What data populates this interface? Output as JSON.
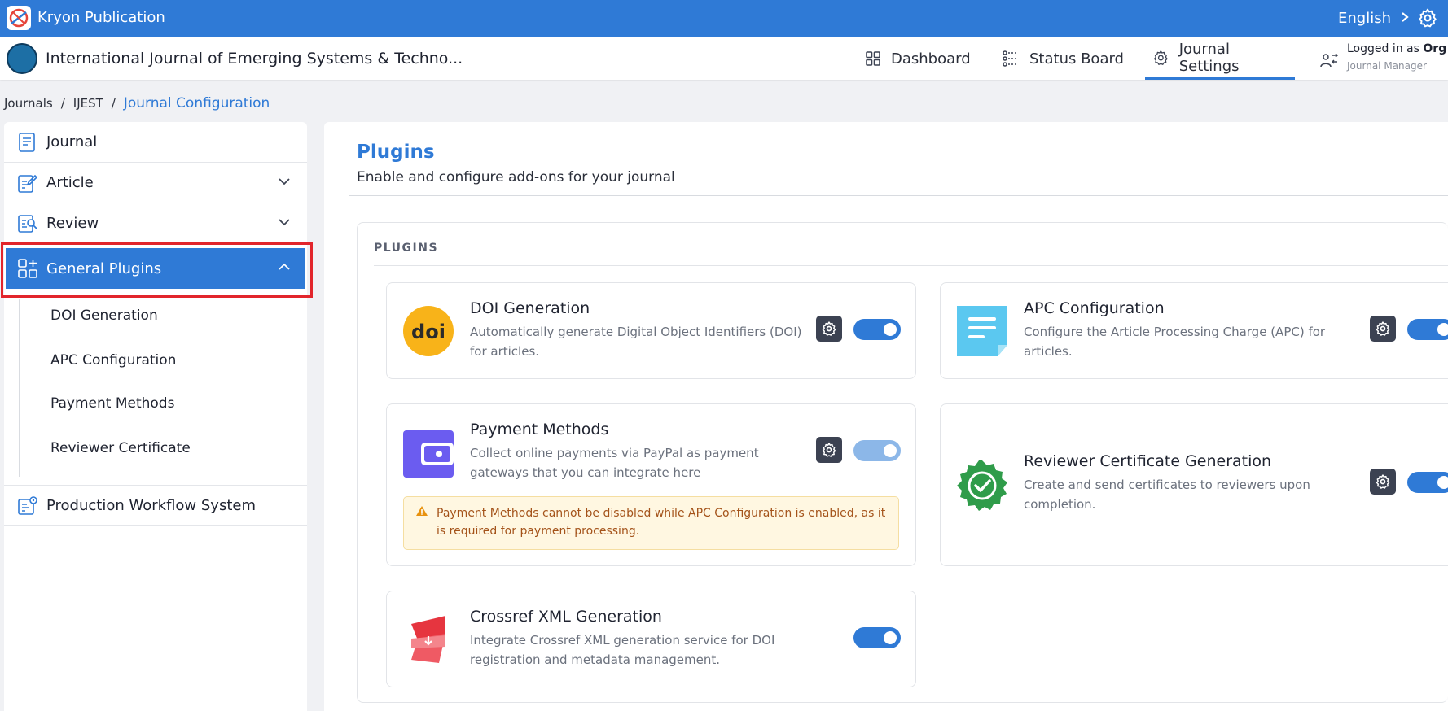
{
  "topbar": {
    "app_title": "Kryon Publication",
    "language": "English",
    "accent_color": "#2f7ad6"
  },
  "journal_bar": {
    "title": "International Journal of Emerging Systems & Techno...",
    "nav": [
      {
        "label": "Dashboard",
        "icon": "grid-icon"
      },
      {
        "label": "Status Board",
        "icon": "status-board-icon"
      },
      {
        "label": "Journal Settings",
        "icon": "gear-icon",
        "active": true
      }
    ],
    "login_prefix": "Logged in as",
    "login_user": "Org",
    "login_role": "Journal Manager"
  },
  "breadcrumb": {
    "items": [
      "Journals",
      "IJEST"
    ],
    "current": "Journal Configuration"
  },
  "sidebar": {
    "items": [
      {
        "label": "Journal",
        "icon": "document-icon"
      },
      {
        "label": "Article",
        "icon": "edit-document-icon"
      },
      {
        "label": "Review",
        "icon": "review-icon"
      },
      {
        "label": "General Plugins",
        "icon": "plugins-icon",
        "active": true
      },
      {
        "label": "Production Workflow System",
        "icon": "workflow-icon"
      }
    ],
    "sub_items": [
      "DOI Generation",
      "APC Configuration",
      "Payment Methods",
      "Reviewer Certificate"
    ]
  },
  "main": {
    "title": "Plugins",
    "subtitle": "Enable and configure add-ons for your journal",
    "section_title": "PLUGINS",
    "plugins": [
      {
        "name": "DOI Generation",
        "description": "Automatically generate Digital Object Identifiers (DOI) for articles.",
        "enabled": true,
        "icon": "doi-icon"
      },
      {
        "name": "APC Configuration",
        "description": "Configure the Article Processing Charge (APC) for articles.",
        "enabled": true,
        "icon": "apc-icon"
      },
      {
        "name": "Payment Methods",
        "description": "Collect online payments via PayPal as payment gateways that you can integrate here",
        "enabled": true,
        "locked": true,
        "icon": "wallet-icon",
        "warning": "Payment Methods cannot be disabled while APC Configuration is enabled, as it is required for payment processing."
      },
      {
        "name": "Reviewer Certificate Generation",
        "description": "Create and send certificates to reviewers upon completion.",
        "enabled": true,
        "icon": "certificate-badge-icon"
      },
      {
        "name": "Crossref XML Generation",
        "description": "Integrate Crossref XML generation service for DOI registration and metadata management.",
        "enabled": true,
        "icon": "crossref-icon"
      }
    ]
  }
}
